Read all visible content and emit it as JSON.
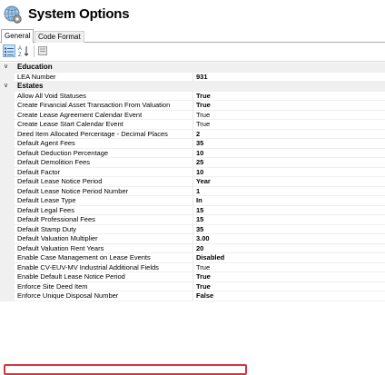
{
  "header": {
    "title": "System Options",
    "icon": "globe-gear-icon"
  },
  "tabs": [
    {
      "label": "General",
      "active": true
    },
    {
      "label": "Code Format",
      "active": false
    }
  ],
  "toolbar": {
    "buttons": [
      "categorized-view-icon",
      "alphabetical-sort-icon",
      "property-pages-icon"
    ]
  },
  "grid": {
    "categories": [
      {
        "label": "Education",
        "rows": [
          {
            "name": "LEA Number",
            "value": "931",
            "bold": true
          }
        ]
      },
      {
        "label": "Estates",
        "rows": [
          {
            "name": "Allow All Void Statuses",
            "value": "True",
            "bold": true
          },
          {
            "name": "Create Financial Asset Transaction From Valuation",
            "value": "True",
            "bold": true
          },
          {
            "name": "Create Lease Agreement Calendar Event",
            "value": "True",
            "bold": false
          },
          {
            "name": "Create Lease Start Calendar Event",
            "value": "True",
            "bold": false
          },
          {
            "name": "Deed Item Allocated Percentage - Decimal Places",
            "value": "2",
            "bold": true
          },
          {
            "name": "Default Agent Fees",
            "value": "35",
            "bold": true
          },
          {
            "name": "Default Deduction Percentage",
            "value": "10",
            "bold": true
          },
          {
            "name": "Default Demolition Fees",
            "value": "25",
            "bold": true
          },
          {
            "name": "Default Factor",
            "value": "10",
            "bold": true
          },
          {
            "name": "Default Lease Notice Period",
            "value": "Year",
            "bold": true
          },
          {
            "name": "Default Lease Notice Period Number",
            "value": "1",
            "bold": true
          },
          {
            "name": "Default Lease Type",
            "value": "In",
            "bold": true
          },
          {
            "name": "Default Legal Fees",
            "value": "15",
            "bold": true
          },
          {
            "name": "Default Professional Fees",
            "value": "15",
            "bold": true
          },
          {
            "name": "Default Stamp Duty",
            "value": "35",
            "bold": true
          },
          {
            "name": "Default Valuation Multiplier",
            "value": "3.00",
            "bold": true
          },
          {
            "name": "Default Valuation Rent Years",
            "value": "20",
            "bold": true
          },
          {
            "name": "Enable Case Management on Lease Events",
            "value": "Disabled",
            "bold": true
          },
          {
            "name": "Enable CV-EUV-MV Industrial Additional Fields",
            "value": "True",
            "bold": false
          },
          {
            "name": "Enable Default Lease Notice Period",
            "value": "True",
            "bold": true
          },
          {
            "name": "Enforce Site Deed Item",
            "value": "True",
            "bold": true,
            "highlighted": true
          },
          {
            "name": "Enforce Unique Disposal Number",
            "value": "False",
            "bold": true
          }
        ]
      }
    ]
  },
  "colors": {
    "highlight": "#d9333f",
    "category_bg": "#f0f0f0",
    "selected_tool": "#cce4f7"
  }
}
